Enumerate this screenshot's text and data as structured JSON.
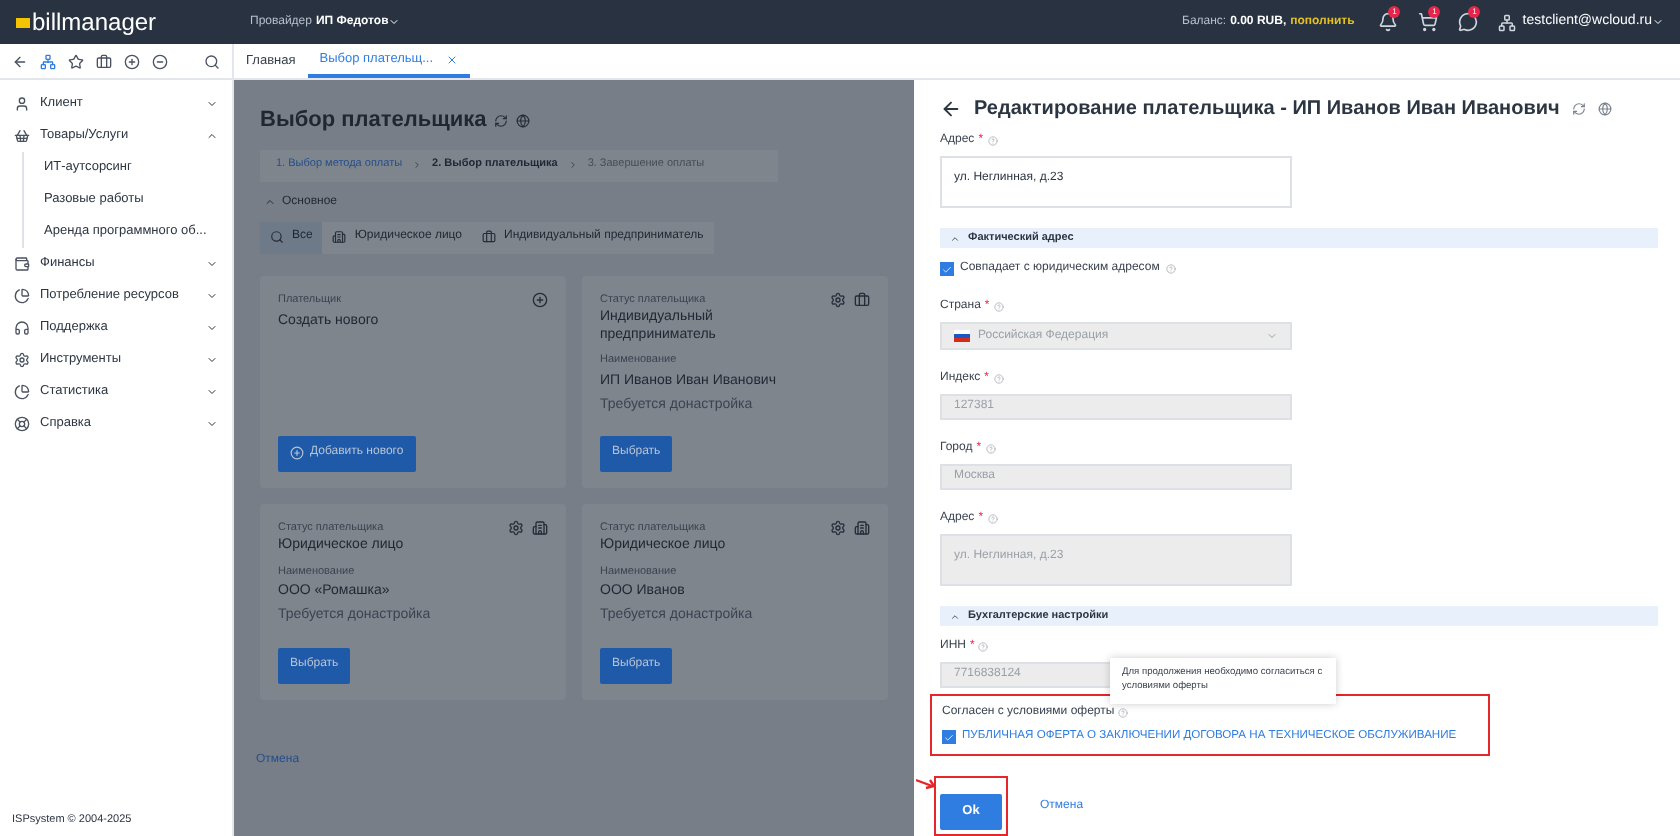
{
  "header": {
    "logo": "billmanager",
    "provider_label": "Провайдер",
    "provider": "ИП Федотов",
    "balance_label": "Баланс:",
    "balance": "0.00 RUB,",
    "topup": "пополнить",
    "badges": [
      "1",
      "1",
      "1"
    ],
    "user": "testclient@wcloud.ru"
  },
  "tabs": [
    {
      "label": "Главная",
      "selected": false,
      "closable": false
    },
    {
      "label": "Выбор плательщ...",
      "selected": true,
      "closable": true
    }
  ],
  "sidebar": {
    "items": [
      {
        "label": "Клиент",
        "expanded": false
      },
      {
        "label": "Товары/Услуги",
        "expanded": true,
        "children": [
          {
            "label": "ИТ-аутсорсинг"
          },
          {
            "label": "Разовые работы"
          },
          {
            "label": "Аренда программного об..."
          }
        ]
      },
      {
        "label": "Финансы",
        "expanded": false
      },
      {
        "label": "Потребление ресурсов",
        "expanded": false
      },
      {
        "label": "Поддержка",
        "expanded": false
      },
      {
        "label": "Инструменты",
        "expanded": false
      },
      {
        "label": "Статистика",
        "expanded": false
      },
      {
        "label": "Справка",
        "expanded": false
      }
    ],
    "footer": "ISPsystem © 2004-2025"
  },
  "main": {
    "title": "Выбор плательщика",
    "steps": [
      {
        "label": "1. Выбор метода оплаты",
        "done": true,
        "selected": false
      },
      {
        "label": "2. Выбор плательщика",
        "done": false,
        "selected": true
      },
      {
        "label": "3. Завершение оплаты",
        "done": false,
        "selected": false
      }
    ],
    "section": "Основное",
    "filters": [
      {
        "label": "Все",
        "selected": true
      },
      {
        "label": "Юридическое лицо",
        "selected": false
      },
      {
        "label": "Индивидуальный предприниматель",
        "selected": false
      }
    ],
    "cards": [
      {
        "kind": "new",
        "label": "Плательщик",
        "value": "Создать нового",
        "button": "Добавить нового"
      },
      {
        "kind": "entrepreneur",
        "status_label": "Статус плательщика",
        "status": "Индивидуальный предприниматель",
        "name_label": "Наименование",
        "name": "ИП Иванов Иван Иванович",
        "note": "Требуется донастройка",
        "button": "Выбрать"
      },
      {
        "kind": "company",
        "status_label": "Статус плательщика",
        "status": "Юридическое лицо",
        "name_label": "Наименование",
        "name": "ООО «Ромашка»",
        "note": "Требуется донастройка",
        "button": "Выбрать"
      },
      {
        "kind": "company",
        "status_label": "Статус плательщика",
        "status": "Юридическое лицо",
        "name_label": "Наименование",
        "name": "ООО Иванов",
        "note": "Требуется донастройка",
        "button": "Выбрать"
      }
    ],
    "cancel": "Отмена"
  },
  "panel": {
    "title": "Редактирование плательщика - ИП Иванов Иван Иванович",
    "fields": [
      {
        "kind": "textarea",
        "label": "Адрес",
        "required": true,
        "value": "ул. Неглинная, д.23",
        "disabled": false
      },
      {
        "kind": "section",
        "label": "Фактический адрес"
      },
      {
        "kind": "checkbox",
        "label": "Совпадает с юридическим адресом",
        "checked": true
      },
      {
        "kind": "select",
        "label": "Страна",
        "required": true,
        "value": "Российская Федерация",
        "disabled": true
      },
      {
        "kind": "input",
        "label": "Индекс",
        "required": true,
        "value": "127381",
        "disabled": true
      },
      {
        "kind": "input",
        "label": "Город",
        "required": true,
        "value": "Москва",
        "disabled": true
      },
      {
        "kind": "textarea",
        "label": "Адрес",
        "required": true,
        "value": "ул. Неглинная, д.23",
        "disabled": true
      },
      {
        "kind": "section",
        "label": "Бухгалтерские настройки"
      },
      {
        "kind": "input",
        "label": "ИНН",
        "required": true,
        "value": "7716838124",
        "disabled": true
      }
    ],
    "required_mark": "*",
    "tooltip": "Для продолжения необходимо согласиться с условиями оферты",
    "agreement": {
      "label": "Согласен с условиями оферты",
      "option": "ПУБЛИЧНАЯ ОФЕРТА О ЗАКЛЮЧЕНИИ ДОГОВОРА НА ТЕХНИЧЕСКОЕ ОБСЛУЖИВАНИЕ",
      "checked": true,
      "highlighted": true
    },
    "ok": {
      "label": "Ok",
      "highlighted": true
    },
    "cancel": "Отмена"
  }
}
